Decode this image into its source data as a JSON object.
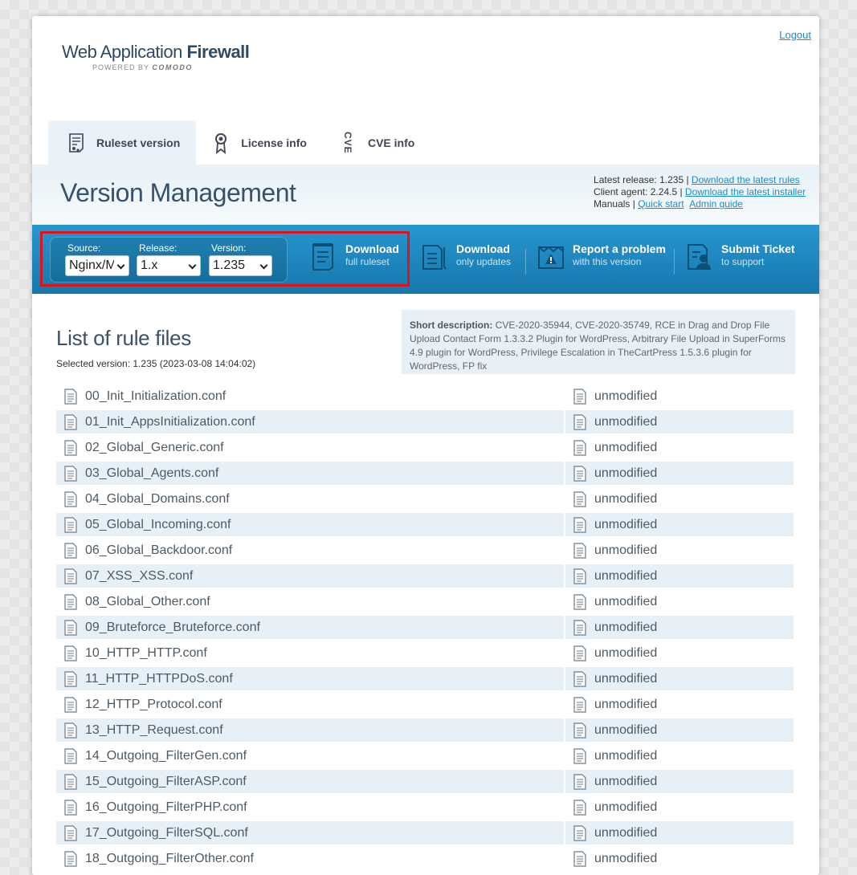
{
  "header": {
    "logo_main_light": "Web Application ",
    "logo_main_bold": "Firewall",
    "logo_powered": "POWERED BY ",
    "logo_brand": "COMODO",
    "logout_label": "Logout"
  },
  "tabs": [
    {
      "label": "Ruleset version",
      "icon": "ruleset-icon",
      "active": true
    },
    {
      "label": "License info",
      "icon": "certificate-icon",
      "active": false
    },
    {
      "label": "CVE info",
      "icon": "cve-icon",
      "icon_text": "CVE",
      "active": false
    }
  ],
  "version_management": {
    "title": "Version Management",
    "latest_release_text": "Latest release: 1.235 | ",
    "latest_release_link": "Download the latest rules",
    "client_agent_text": "Client agent: 2.24.5 | ",
    "client_agent_link": "Download the latest installer",
    "manuals_text": "Manuals | ",
    "quick_start_link": "Quick start",
    "admin_guide_link": "Admin guide"
  },
  "toolbar": {
    "source_label": "Source:",
    "source_value": "Nginx/M",
    "release_label": "Release:",
    "release_value": "1.x",
    "version_label": "Version:",
    "version_value": "1.235",
    "download_full_main": "Download",
    "download_full_sub": "full ruleset",
    "download_updates_main": "Download",
    "download_updates_sub": "only updates",
    "report_main": "Report a problem",
    "report_sub": "with this version",
    "ticket_main": "Submit Ticket",
    "ticket_sub": "to support"
  },
  "rules": {
    "title": "List of rule files",
    "selected_version": "Selected version: 1.235 (2023-03-08 14:04:02)",
    "short_desc_label": "Short description:",
    "short_desc_text": " CVE-2020-35944, CVE-2020-35749, RCE in Drag and Drop File Upload Contact Form 1.3.3.2 Plugin for WordPress, Arbitrary File Upload in SuperForms 4.9 plugin for WordPress, Privilege Escalation in TheCartPress 1.5.3.6 plugin for WordPress, FP fix",
    "files": [
      {
        "name": "00_Init_Initialization.conf",
        "status": "unmodified"
      },
      {
        "name": "01_Init_AppsInitialization.conf",
        "status": "unmodified"
      },
      {
        "name": "02_Global_Generic.conf",
        "status": "unmodified"
      },
      {
        "name": "03_Global_Agents.conf",
        "status": "unmodified"
      },
      {
        "name": "04_Global_Domains.conf",
        "status": "unmodified"
      },
      {
        "name": "05_Global_Incoming.conf",
        "status": "unmodified"
      },
      {
        "name": "06_Global_Backdoor.conf",
        "status": "unmodified"
      },
      {
        "name": "07_XSS_XSS.conf",
        "status": "unmodified"
      },
      {
        "name": "08_Global_Other.conf",
        "status": "unmodified"
      },
      {
        "name": "09_Bruteforce_Bruteforce.conf",
        "status": "unmodified"
      },
      {
        "name": "10_HTTP_HTTP.conf",
        "status": "unmodified"
      },
      {
        "name": "11_HTTP_HTTPDoS.conf",
        "status": "unmodified"
      },
      {
        "name": "12_HTTP_Protocol.conf",
        "status": "unmodified"
      },
      {
        "name": "13_HTTP_Request.conf",
        "status": "unmodified"
      },
      {
        "name": "14_Outgoing_FilterGen.conf",
        "status": "unmodified"
      },
      {
        "name": "15_Outgoing_FilterASP.conf",
        "status": "unmodified"
      },
      {
        "name": "16_Outgoing_FilterPHP.conf",
        "status": "unmodified"
      },
      {
        "name": "17_Outgoing_FilterSQL.conf",
        "status": "unmodified"
      },
      {
        "name": "18_Outgoing_FilterOther.conf",
        "status": "unmodified"
      }
    ]
  },
  "colors": {
    "accent": "#1a8dc4",
    "toolbar": "#1f88c0",
    "highlight": "#e0131c",
    "row_alt": "#e7f0f6"
  }
}
